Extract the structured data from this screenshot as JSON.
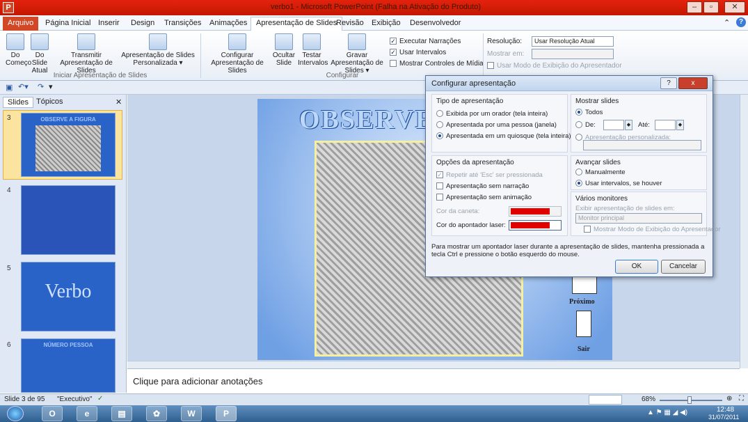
{
  "window": {
    "title": "verbo1 - Microsoft PowerPoint (Falha na Ativação do Produto)",
    "app_icon": "P"
  },
  "menu": {
    "tabs": [
      "Arquivo",
      "Página Inicial",
      "Inserir",
      "Design",
      "Transições",
      "Animações",
      "Apresentação de Slides",
      "Revisão",
      "Exibição",
      "Desenvolvedor"
    ]
  },
  "ribbon": {
    "btn_do_comeco": "Do Começo",
    "btn_do_slide_atual": "Do Slide Atual",
    "btn_transmitir": "Transmitir Apresentação de Slides",
    "btn_personalizada": "Apresentação de Slides Personalizada ▾",
    "group1": "Iniciar Apresentação de Slides",
    "btn_configurar": "Configurar Apresentação de Slides",
    "btn_ocultar": "Ocultar Slide",
    "btn_testar": "Testar Intervalos",
    "btn_gravar": "Gravar Apresentação de Slides ▾",
    "chk_narracoes": "Executar Narrações",
    "chk_intervalos": "Usar Intervalos",
    "chk_controles": "Mostrar Controles de Mídia",
    "group2": "Configurar",
    "resolucao_label": "Resolução:",
    "resolucao_value": "Usar Resolução Atual",
    "mostrar_em": "Mostrar em:",
    "chk_apresentador": "Usar Modo de Exibição do Apresentador"
  },
  "panel": {
    "tab_slides": "Slides",
    "tab_topicos": "Tópicos",
    "nums": [
      "3",
      "4",
      "5",
      "6"
    ],
    "t3": "OBSERVE A FIGURA",
    "t5": "Verbo",
    "t6": "NÚMERO PESSOA"
  },
  "slide": {
    "title": "OBSERVE",
    "proximo": "Próximo",
    "sair": "Sair"
  },
  "notes": {
    "placeholder": "Clique para adicionar anotações"
  },
  "status": {
    "slide": "Slide 3 de 95",
    "theme": "\"Executivo\"",
    "zoom": "68%"
  },
  "taskbar": {
    "time": "12:48",
    "date": "31/07/2011"
  },
  "dialog": {
    "title": "Configurar apresentação",
    "help": "?",
    "close": "x",
    "tipo": "Tipo de apresentação",
    "tipo_opts": [
      "Exibida por um orador (tela inteira)",
      "Apresentada por uma pessoa (janela)",
      "Apresentada em um quiosque (tela inteira)"
    ],
    "mostrar": "Mostrar slides",
    "todos": "Todos",
    "de": "De:",
    "ate": "Até:",
    "personalizada": "Apresentação personalizada:",
    "opcoes": "Opções da apresentação",
    "op1": "Repetir até 'Esc' ser pressionada",
    "op2": "Apresentação sem narração",
    "op3": "Apresentação sem animação",
    "cor_caneta": "Cor da caneta:",
    "cor_laser": "Cor do apontador laser:",
    "avancar": "Avançar slides",
    "manual": "Manualmente",
    "usar_int": "Usar intervalos, se houver",
    "monitores": "Vários monitores",
    "exibir_em": "Exibir apresentação de slides em:",
    "monitor_val": "Monitor principal",
    "mostrar_modo": "Mostrar Modo de Exibição do Apresentador",
    "info": "Para mostrar um apontador laser durante a apresentação de slides, mantenha pressionada a tecla Ctrl e pressione o botão esquerdo do mouse.",
    "ok": "OK",
    "cancel": "Cancelar",
    "pen_color": "#e00000",
    "laser_color": "#e00000"
  }
}
